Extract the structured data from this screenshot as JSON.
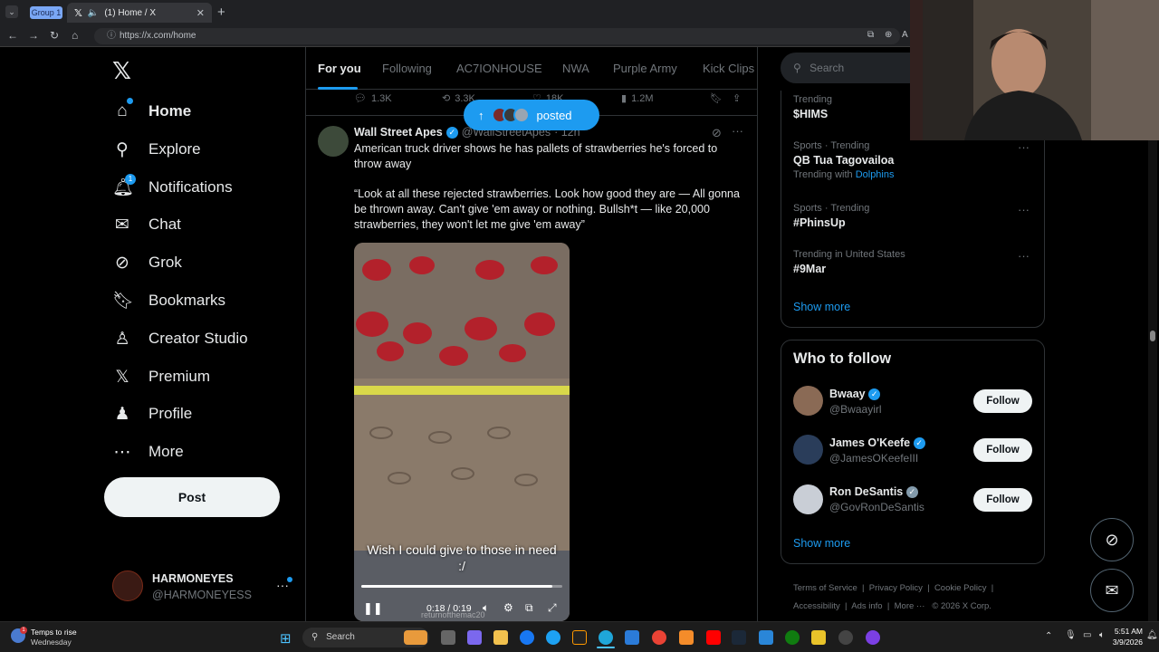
{
  "browser": {
    "group_label": "Group 1",
    "tab_title": "(1) Home / X",
    "url": "https://x.com/home"
  },
  "nav": {
    "items": [
      {
        "label": "Home",
        "icon": "home-icon"
      },
      {
        "label": "Explore",
        "icon": "search-icon"
      },
      {
        "label": "Notifications",
        "icon": "bell-icon"
      },
      {
        "label": "Chat",
        "icon": "mail-icon"
      },
      {
        "label": "Grok",
        "icon": "grok-icon"
      },
      {
        "label": "Bookmarks",
        "icon": "bookmark-icon"
      },
      {
        "label": "Creator Studio",
        "icon": "creator-studio-icon"
      },
      {
        "label": "Premium",
        "icon": "x-logo-icon"
      },
      {
        "label": "Profile",
        "icon": "person-icon"
      },
      {
        "label": "More",
        "icon": "more-circle-icon"
      }
    ],
    "notification_badge": "1",
    "post_label": "Post",
    "account": {
      "name": "HARMONEYES",
      "handle": "@HARMONEYESS"
    }
  },
  "feed": {
    "tabs": [
      "For you",
      "Following",
      "AC7IONHOUSE",
      "NWA",
      "Purple Army",
      "Kick Clips"
    ],
    "prev_tweet_actions": {
      "replies": "1.3K",
      "reposts": "3.3K",
      "likes": "18K",
      "views": "1.2M"
    },
    "posted_pill": "posted",
    "tweet": {
      "author": "Wall Street Apes",
      "handle": "@WallStreetApes",
      "time": "· 12h",
      "text_line1": "American truck driver shows he has pallets of strawberries he's forced to throw away",
      "text_line2": "“Look at all these rejected strawberries. Look how good they are — All gonna be thrown away. Can't give 'em away or nothing. Bullsh*t — like 20,000 strawberries, they won't let me give 'em away”",
      "video_caption": "Wish I could give to those in need :/",
      "video_watermark": "returnofthemac20",
      "video_time": "0:18 / 0:19",
      "video_progress": 0.95
    }
  },
  "right": {
    "search_placeholder": "Search",
    "trends": [
      {
        "meta": "Trending",
        "name": "$HIMS",
        "extra": "",
        "extra_link": ""
      },
      {
        "meta": "Sports · Trending",
        "name": "QB Tua Tagovailoa",
        "extra": "Trending with",
        "extra_link": "Dolphins"
      },
      {
        "meta": "Sports · Trending",
        "name": "#PhinsUp",
        "extra": "",
        "extra_link": ""
      },
      {
        "meta": "Trending in United States",
        "name": "#9Mar",
        "extra": "",
        "extra_link": ""
      }
    ],
    "show_more": "Show more",
    "who_to_follow_title": "Who to follow",
    "follow_suggestions": [
      {
        "name": "Bwaay",
        "handle": "@Bwaayirl",
        "follow": "Follow",
        "verified_color": "#1d9bf0"
      },
      {
        "name": "James O'Keefe",
        "handle": "@JamesOKeefeIII",
        "follow": "Follow",
        "verified_color": "#1d9bf0"
      },
      {
        "name": "Ron DeSantis",
        "handle": "@GovRonDeSantis",
        "follow": "Follow",
        "verified_color": "#829aab"
      }
    ],
    "show_more_2": "Show more",
    "footer": [
      "Terms of Service",
      "Privacy Policy",
      "Cookie Policy",
      "Accessibility",
      "Ads info",
      "More ···",
      "© 2026 X Corp."
    ]
  },
  "taskbar": {
    "weather_title": "Temps to rise",
    "weather_sub": "Wednesday",
    "weather_badge": "1",
    "search_label": "Search",
    "time": "5:51 AM",
    "date": "3/9/2026"
  },
  "colors": {
    "accent": "#1d9bf0",
    "background": "#000000",
    "border": "#2f3336",
    "muted": "#71767b"
  }
}
